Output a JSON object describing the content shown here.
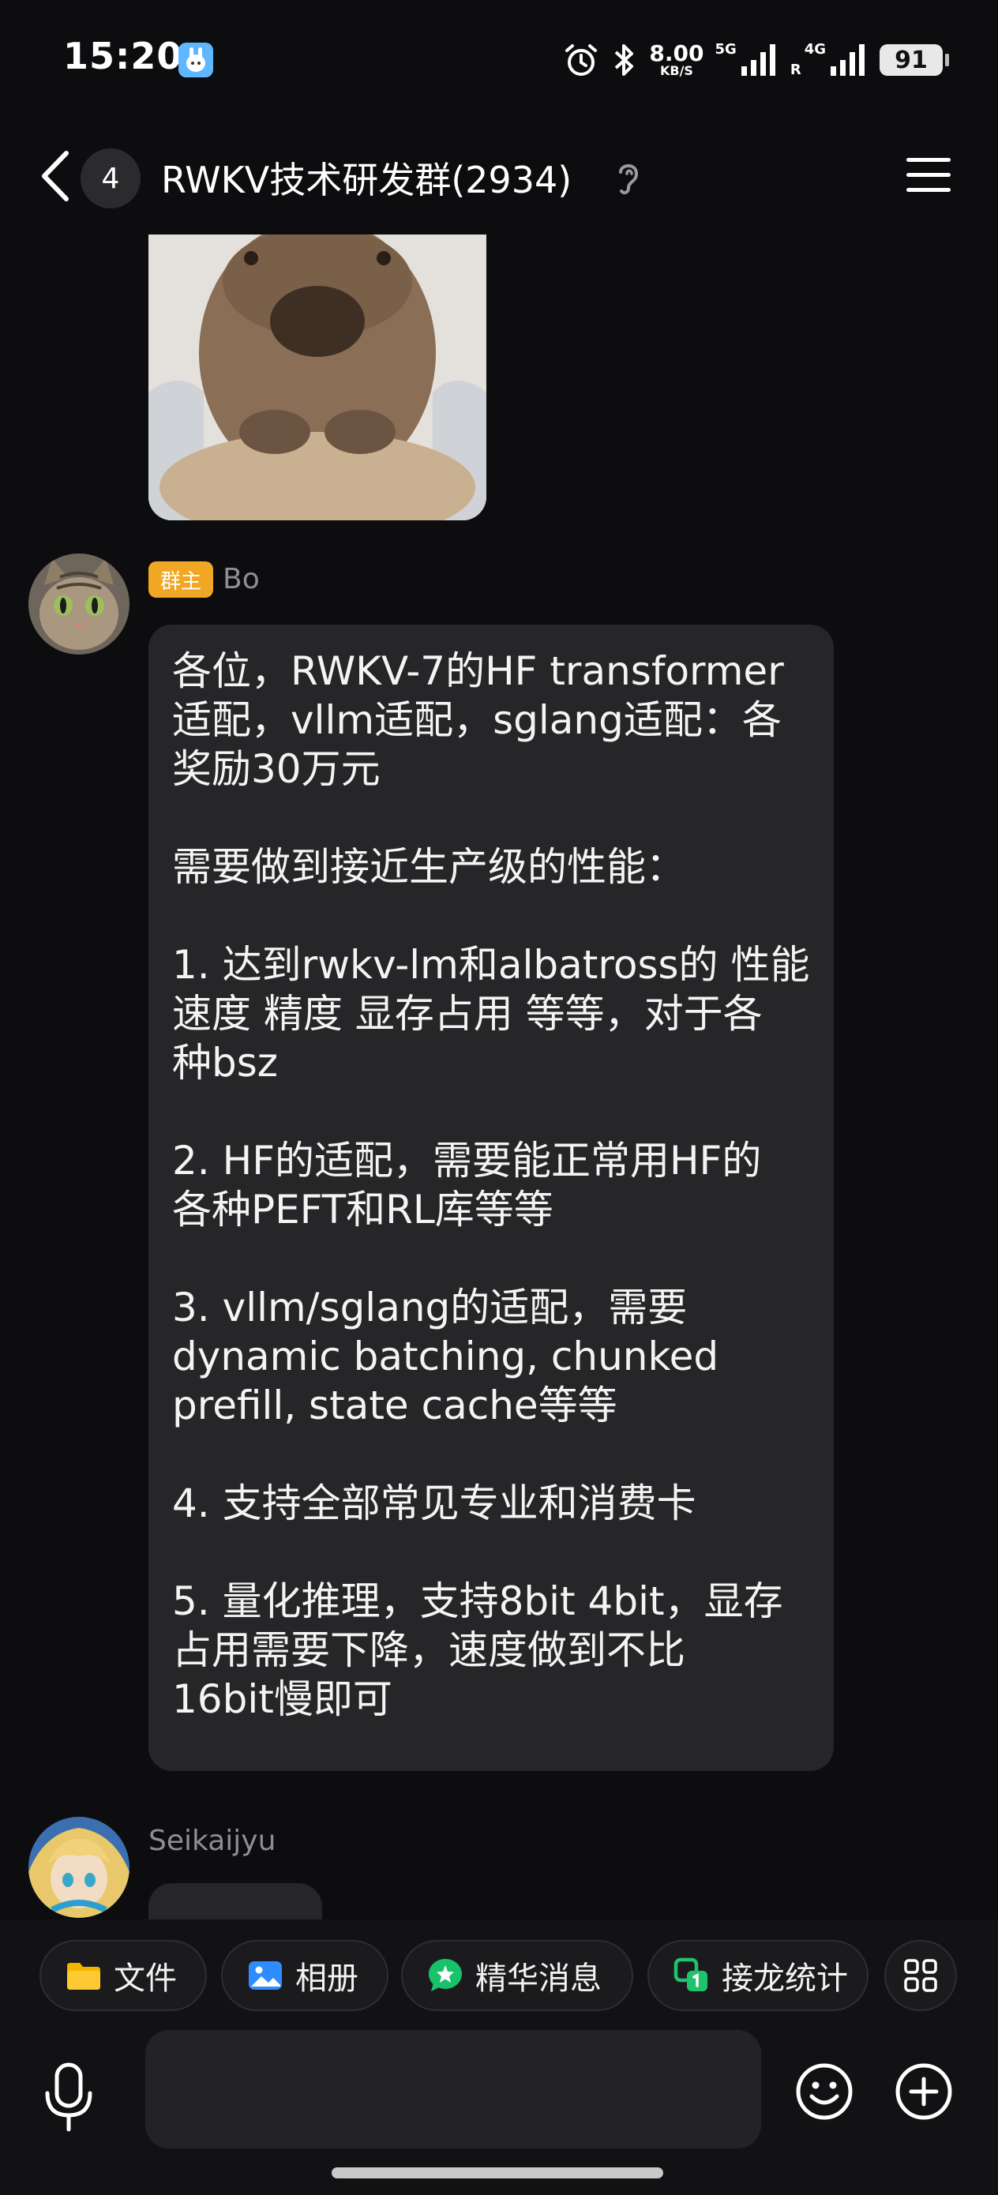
{
  "status_bar": {
    "time": "15:20",
    "net_speed_value": "8.00",
    "net_speed_unit": "KB/S",
    "sim1_tag": "5G",
    "sim2_tag": "4G",
    "sim2_roaming": "R",
    "battery": "91",
    "icons": [
      "app-notification-icon",
      "alarm-icon",
      "bluetooth-icon",
      "signal-5g-icon",
      "signal-4g-icon",
      "battery-icon"
    ]
  },
  "header": {
    "unread_count": "4",
    "title": "RWKV技术研发群(2934)",
    "icons": [
      "back-chevron-icon",
      "ear-icon",
      "menu-icon"
    ]
  },
  "messages": [
    {
      "type": "image",
      "description_icon": "capybara-sticker"
    },
    {
      "type": "text",
      "role_badge": "群主",
      "sender": "Bo",
      "lines": [
        "各位，RWKV-7的HF transformer",
        "适配，vllm适配，sglang适配：各",
        "奖励30万元",
        "",
        "需要做到接近生产级的性能：",
        "",
        "1. 达到rwkv-lm和albatross的 性能",
        "速度 精度 显存占用 等等，对于各",
        "种bsz",
        "",
        "2. HF的适配，需要能正常用HF的",
        "各种PEFT和RL库等等",
        "",
        "3. vllm/sglang的适配，需要",
        "dynamic batching, chunked",
        "prefill, state cache等等",
        "",
        "4. 支持全部常见专业和消费卡",
        "",
        "5. 量化推理，支持8bit 4bit，显存",
        "占用需要下降，速度做到不比",
        "16bit慢即可"
      ]
    },
    {
      "type": "text",
      "sender": "Seikaijyu"
    }
  ],
  "shortcuts": [
    {
      "label": "文件",
      "icon": "folder-icon",
      "color": "#f5b400"
    },
    {
      "label": "相册",
      "icon": "photo-icon",
      "color": "#2f8cff"
    },
    {
      "label": "精华消息",
      "icon": "star-chat-icon",
      "color": "#18c26b"
    },
    {
      "label": "接龙统计",
      "icon": "chain-icon",
      "color": "#21c26e"
    }
  ],
  "input": {
    "placeholder": ""
  }
}
